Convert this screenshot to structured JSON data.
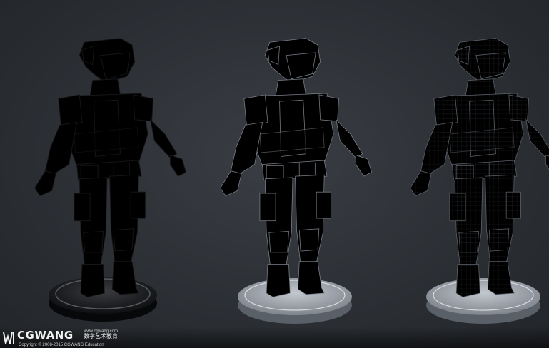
{
  "image": {
    "subject": "Three renders of the same armored soldier character on round pedestals: textured, untextured grey, and grey with wireframe",
    "background_color": "#2c3035"
  },
  "figures": [
    {
      "variant": "textured",
      "palette": {
        "base": "#2b2c2c",
        "mid": "#4a4d48",
        "light": "#6f6f66"
      }
    },
    {
      "variant": "clay",
      "palette": {
        "base": "#9ea3ab",
        "mid": "#b9bec5",
        "light": "#d6dade"
      }
    },
    {
      "variant": "wireframe",
      "palette": {
        "base": "#9aa0a8",
        "mid": "#b4b9c0",
        "light": "#d2d6db"
      }
    }
  ],
  "watermark": {
    "brand": "CGWANG",
    "url": "www.cgwang.com",
    "chinese": "数字艺术教育",
    "copyright": "Copyright © 2008-2015 CGWANG Education"
  }
}
